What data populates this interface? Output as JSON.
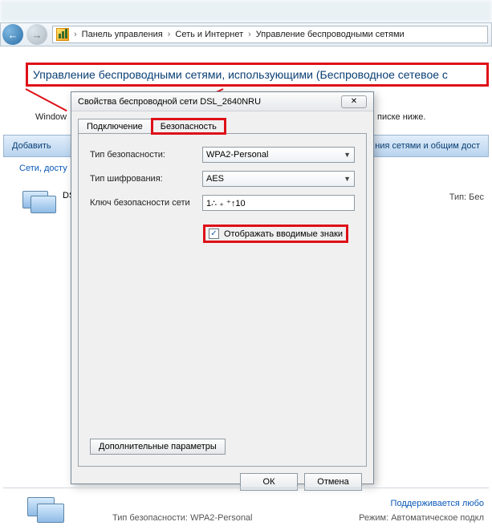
{
  "breadcrumb": {
    "items": [
      "Панель управления",
      "Сеть и Интернет",
      "Управление беспроводными сетями"
    ],
    "sep": "›"
  },
  "heading": "Управление беспроводными сетями, использующими (Беспроводное сетевое с",
  "window_line_left": "Window",
  "window_line_right": "писке ниже.",
  "cmdbar": {
    "add": "Добавить",
    "right": "ния сетями и общим дост"
  },
  "links": {
    "avail": "Сети, досту"
  },
  "list": {
    "item0": "DS",
    "type_label": "Тип: Бес"
  },
  "dialog": {
    "title": "Свойства беспроводной сети DSL_2640NRU",
    "close": "✕",
    "tabs": {
      "conn": "Подключение",
      "sec": "Безопасность"
    },
    "fields": {
      "sec_type_label": "Тип безопасности:",
      "sec_type_value": "WPA2-Personal",
      "enc_label": "Тип шифрования:",
      "enc_value": "AES",
      "key_label": "Ключ безопасности сети",
      "key_value": "1∴ ₊ ⁺↑10"
    },
    "show_chars": "Отображать вводимые знаки",
    "advanced": "Дополнительные параметры",
    "ok": "ОК",
    "cancel": "Отмена"
  },
  "status": {
    "supports": "Поддерживается любо",
    "sec_label": "Тип безопасности:",
    "sec_val": "WPA2-Personal",
    "mode_label": "Режим:",
    "mode_val": "Автоматическое подкл"
  }
}
